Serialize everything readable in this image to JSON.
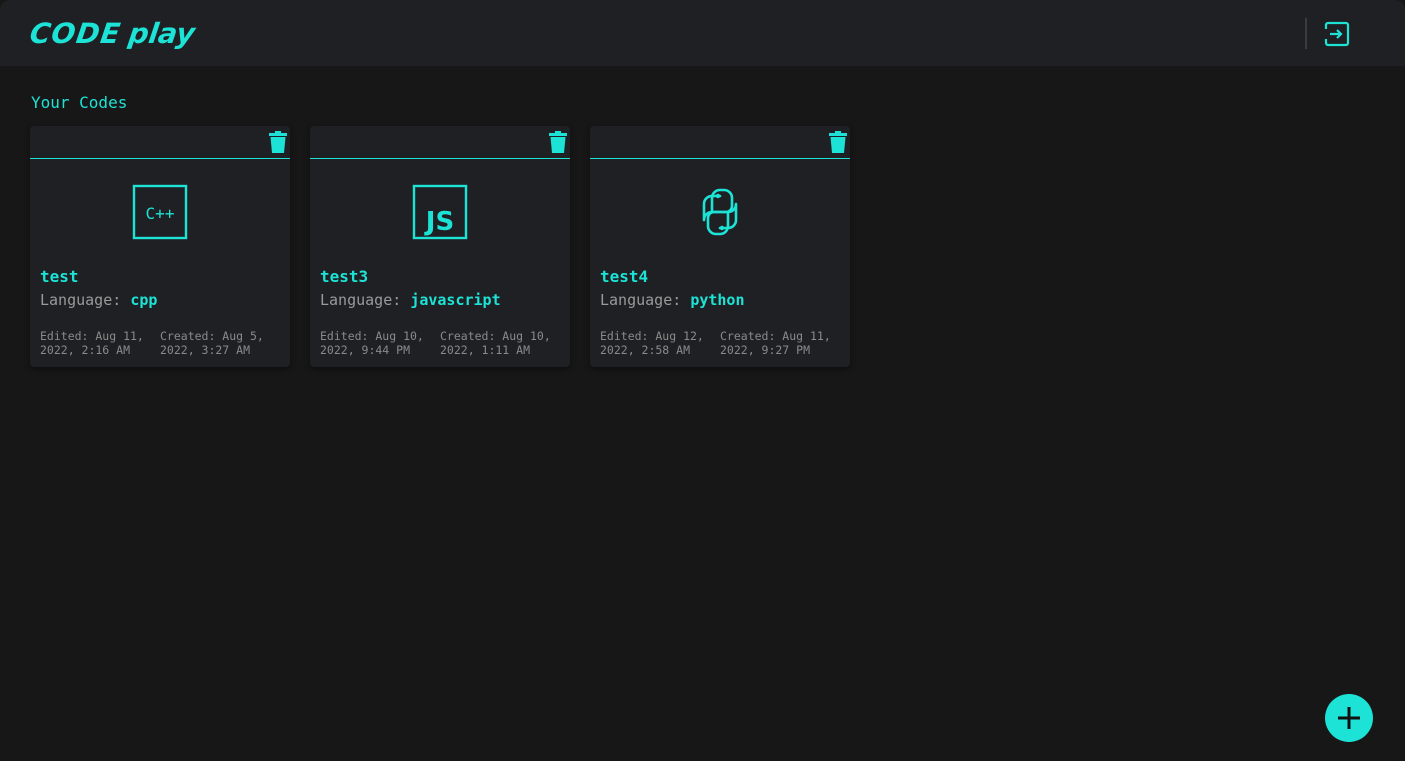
{
  "app": {
    "logo_part1": "CODE",
    "logo_part2": "play",
    "accent_color": "#1de3d6",
    "logout_icon": "logout-icon"
  },
  "main": {
    "section_title": "Your Codes",
    "cards": [
      {
        "title": "test",
        "language_label": "Language:",
        "language": "cpp",
        "icon": "cpp-icon",
        "icon_text": "C++",
        "edited": "Edited: Aug 11, 2022, 2:16 AM",
        "created": "Created: Aug 5, 2022, 3:27 AM"
      },
      {
        "title": "test3",
        "language_label": "Language:",
        "language": "javascript",
        "icon": "javascript-icon",
        "icon_text": "JS",
        "edited": "Edited: Aug 10, 2022, 9:44 PM",
        "created": "Created: Aug 10, 2022, 1:11 AM"
      },
      {
        "title": "test4",
        "language_label": "Language:",
        "language": "python",
        "icon": "python-icon",
        "edited": "Edited: Aug 12, 2022, 2:58 AM",
        "created": "Created: Aug 11, 2022, 9:27 PM"
      }
    ]
  },
  "fab": {
    "icon": "plus-icon"
  }
}
